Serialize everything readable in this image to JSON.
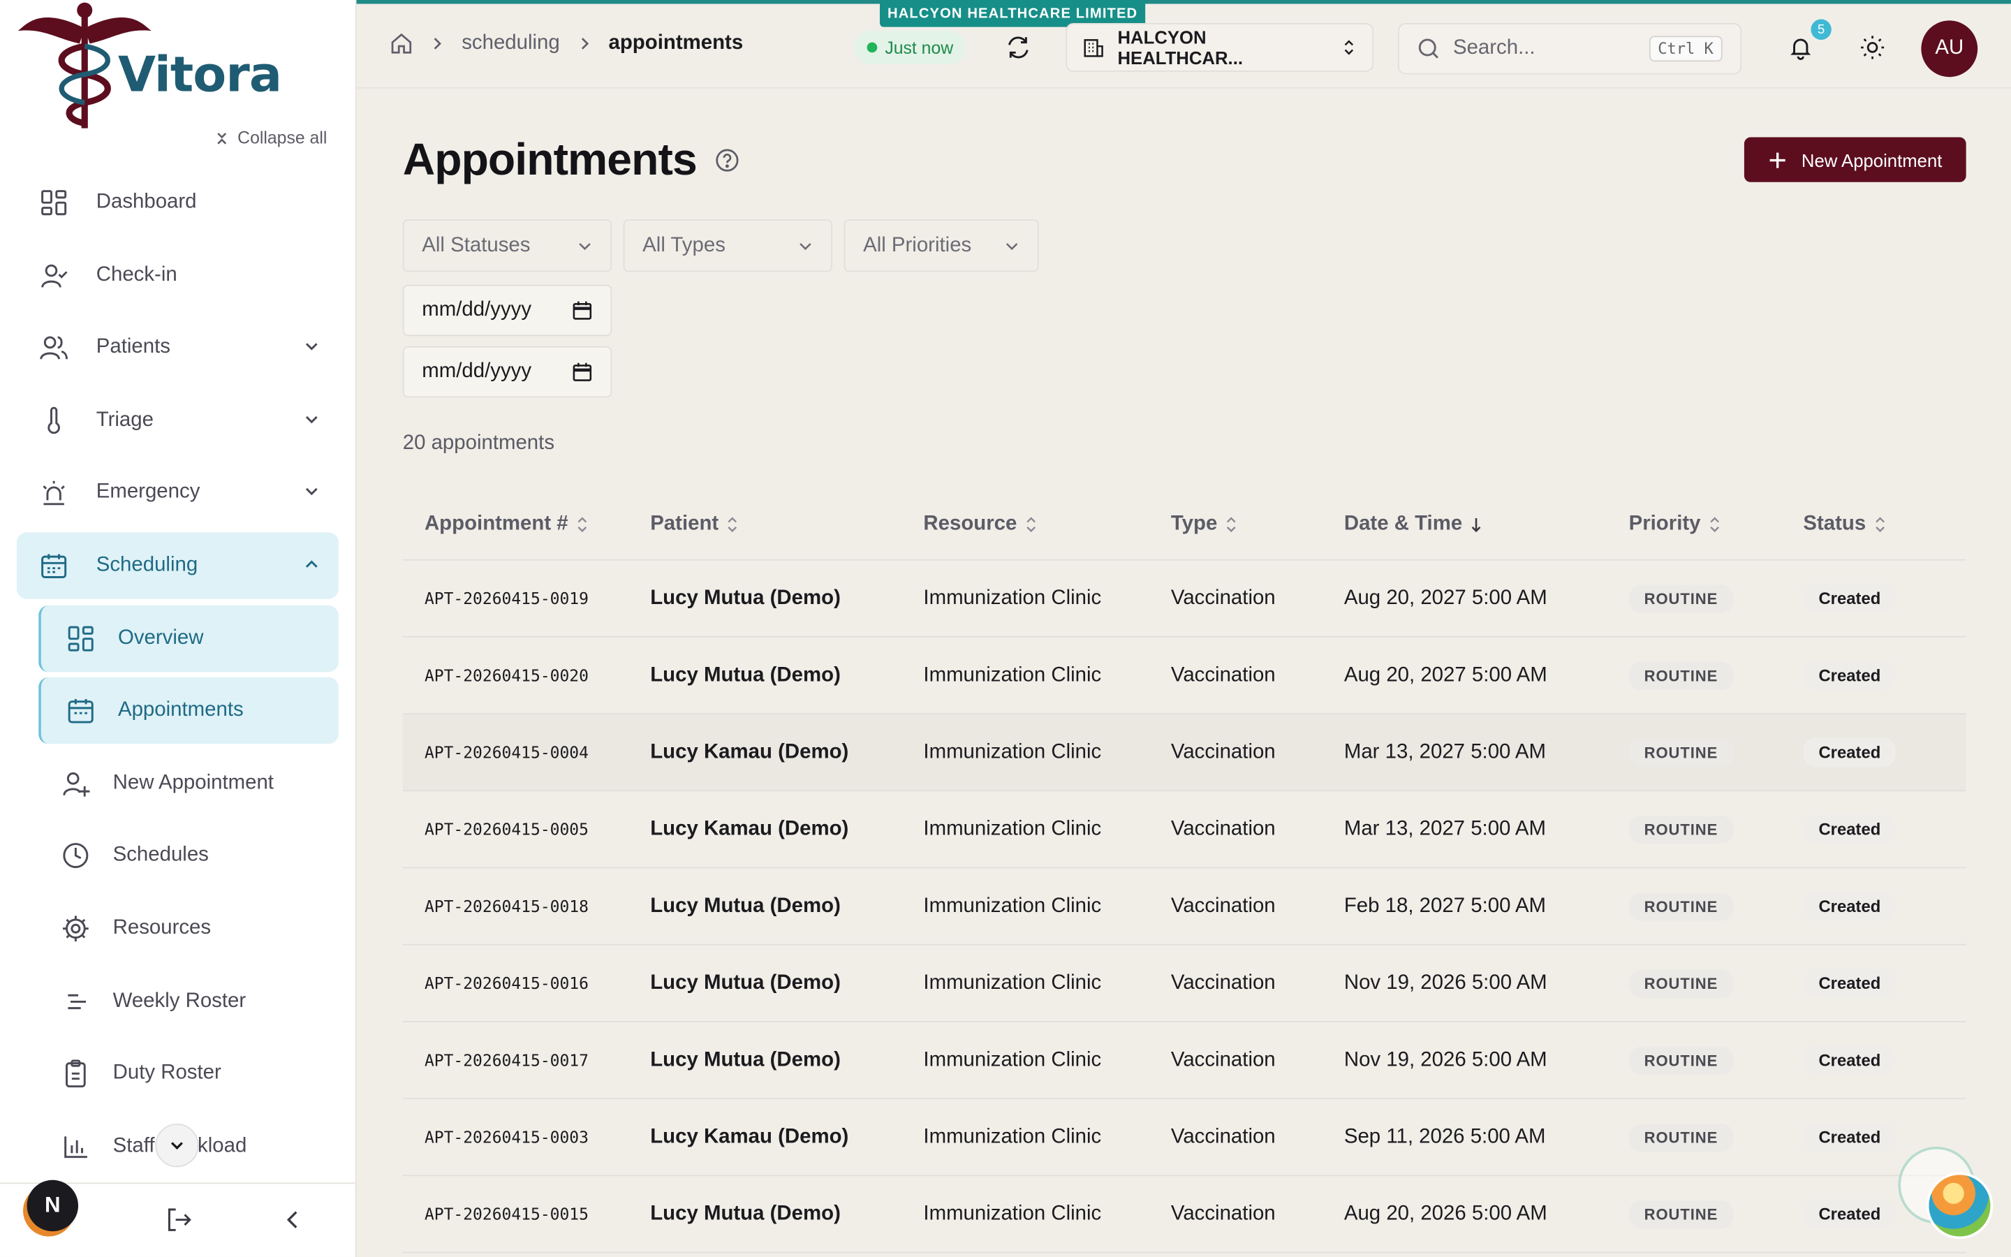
{
  "app": {
    "brand": "Vitora",
    "collapse_all": "Collapse all",
    "org_banner": "HALCYON HEALTHCARE LIMITED",
    "accent": "#5c0e1e",
    "teal": "#1f6a86"
  },
  "sidebar": {
    "items": [
      {
        "label": "Dashboard"
      },
      {
        "label": "Check-in"
      },
      {
        "label": "Patients"
      },
      {
        "label": "Triage"
      },
      {
        "label": "Emergency"
      },
      {
        "label": "Scheduling"
      }
    ],
    "sub_items": [
      {
        "label": "Overview"
      },
      {
        "label": "Appointments"
      },
      {
        "label": "New Appointment"
      },
      {
        "label": "Schedules"
      },
      {
        "label": "Resources"
      },
      {
        "label": "Weekly Roster"
      },
      {
        "label": "Duty Roster"
      },
      {
        "label": "Staff Workload"
      }
    ],
    "user_initial": "N"
  },
  "topbar": {
    "crumbs": [
      "scheduling",
      "appointments"
    ],
    "status": "Just now",
    "org_select": "HALCYON HEALTHCAR...",
    "search_placeholder": "Search...",
    "shortcut": "Ctrl K",
    "notifications": "5",
    "avatar": "AU"
  },
  "page": {
    "title": "Appointments",
    "new_button": "New Appointment",
    "filters": {
      "status": "All Statuses",
      "type": "All Types",
      "priority": "All Priorities"
    },
    "date_from": "mm/dd/yyyy",
    "date_to": "mm/dd/yyyy",
    "count": "20 appointments"
  },
  "table": {
    "headers": [
      "Appointment #",
      "Patient",
      "Resource",
      "Type",
      "Date & Time",
      "Priority",
      "Status"
    ],
    "rows": [
      {
        "id": "APT-20260415-0019",
        "patient": "Lucy Mutua (Demo)",
        "resource": "Immunization Clinic",
        "type": "Vaccination",
        "datetime": "Aug 20, 2027 5:00 AM",
        "priority": "ROUTINE",
        "status": "Created"
      },
      {
        "id": "APT-20260415-0020",
        "patient": "Lucy Mutua (Demo)",
        "resource": "Immunization Clinic",
        "type": "Vaccination",
        "datetime": "Aug 20, 2027 5:00 AM",
        "priority": "ROUTINE",
        "status": "Created"
      },
      {
        "id": "APT-20260415-0004",
        "patient": "Lucy Kamau (Demo)",
        "resource": "Immunization Clinic",
        "type": "Vaccination",
        "datetime": "Mar 13, 2027 5:00 AM",
        "priority": "ROUTINE",
        "status": "Created"
      },
      {
        "id": "APT-20260415-0005",
        "patient": "Lucy Kamau (Demo)",
        "resource": "Immunization Clinic",
        "type": "Vaccination",
        "datetime": "Mar 13, 2027 5:00 AM",
        "priority": "ROUTINE",
        "status": "Created"
      },
      {
        "id": "APT-20260415-0018",
        "patient": "Lucy Mutua (Demo)",
        "resource": "Immunization Clinic",
        "type": "Vaccination",
        "datetime": "Feb 18, 2027 5:00 AM",
        "priority": "ROUTINE",
        "status": "Created"
      },
      {
        "id": "APT-20260415-0016",
        "patient": "Lucy Mutua (Demo)",
        "resource": "Immunization Clinic",
        "type": "Vaccination",
        "datetime": "Nov 19, 2026 5:00 AM",
        "priority": "ROUTINE",
        "status": "Created"
      },
      {
        "id": "APT-20260415-0017",
        "patient": "Lucy Mutua (Demo)",
        "resource": "Immunization Clinic",
        "type": "Vaccination",
        "datetime": "Nov 19, 2026 5:00 AM",
        "priority": "ROUTINE",
        "status": "Created"
      },
      {
        "id": "APT-20260415-0003",
        "patient": "Lucy Kamau (Demo)",
        "resource": "Immunization Clinic",
        "type": "Vaccination",
        "datetime": "Sep 11, 2026 5:00 AM",
        "priority": "ROUTINE",
        "status": "Created"
      },
      {
        "id": "APT-20260415-0015",
        "patient": "Lucy Mutua (Demo)",
        "resource": "Immunization Clinic",
        "type": "Vaccination",
        "datetime": "Aug 20, 2026 5:00 AM",
        "priority": "ROUTINE",
        "status": "Created"
      }
    ]
  }
}
